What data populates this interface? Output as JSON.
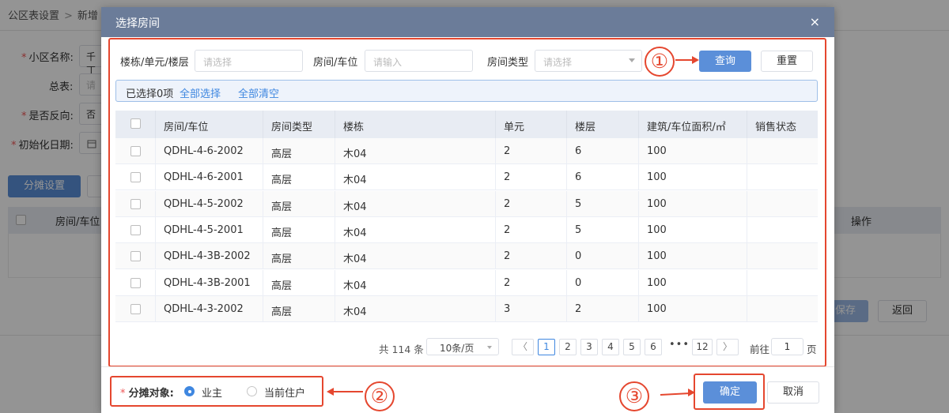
{
  "background": {
    "breadcrumb": [
      "公区表设置",
      "新增"
    ],
    "fields": [
      {
        "label": "小区名称:",
        "required": true,
        "value": "千丁"
      },
      {
        "label": "总表:",
        "required": false,
        "value": "请"
      },
      {
        "label": "是否反向:",
        "required": true,
        "value": "否"
      },
      {
        "label": "初始化日期:",
        "required": true,
        "value": ""
      }
    ],
    "allot_button": "分摊设置",
    "table_headers": [
      "房间/车位",
      "操作"
    ],
    "save_button": "保存",
    "back_button": "返回"
  },
  "dialog": {
    "title": "选择房间",
    "close_icon": "×",
    "filters": {
      "building_label": "楼栋/单元/楼层",
      "building_placeholder": "请选择",
      "room_label": "房间/车位",
      "room_placeholder": "请输入",
      "type_label": "房间类型",
      "type_placeholder": "请选择",
      "query_button": "查询",
      "reset_button": "重置"
    },
    "selection": {
      "count_text": "已选择0项",
      "select_all": "全部选择",
      "clear_all": "全部清空"
    },
    "columns": [
      "房间/车位",
      "房间类型",
      "楼栋",
      "单元",
      "楼层",
      "建筑/车位面积/㎡",
      "销售状态"
    ],
    "rows": [
      {
        "room": "QDHL-4-6-2002",
        "type": "高层",
        "building": "木04",
        "unit": "2",
        "floor": "6",
        "area": "100",
        "status": ""
      },
      {
        "room": "QDHL-4-6-2001",
        "type": "高层",
        "building": "木04",
        "unit": "2",
        "floor": "6",
        "area": "100",
        "status": ""
      },
      {
        "room": "QDHL-4-5-2002",
        "type": "高层",
        "building": "木04",
        "unit": "2",
        "floor": "5",
        "area": "100",
        "status": ""
      },
      {
        "room": "QDHL-4-5-2001",
        "type": "高层",
        "building": "木04",
        "unit": "2",
        "floor": "5",
        "area": "100",
        "status": ""
      },
      {
        "room": "QDHL-4-3B-2002",
        "type": "高层",
        "building": "木04",
        "unit": "2",
        "floor": "0",
        "area": "100",
        "status": ""
      },
      {
        "room": "QDHL-4-3B-2001",
        "type": "高层",
        "building": "木04",
        "unit": "2",
        "floor": "0",
        "area": "100",
        "status": ""
      },
      {
        "room": "QDHL-4-3-2002",
        "type": "高层",
        "building": "木04",
        "unit": "3",
        "floor": "2",
        "area": "100",
        "status": ""
      }
    ],
    "pagination": {
      "total": "共 114 条",
      "page_size": "10条/页",
      "prev_icon": "〈",
      "next_icon": "〉",
      "pages": [
        "1",
        "2",
        "3",
        "4",
        "5",
        "6"
      ],
      "ellipsis": "•••",
      "last_page": "12",
      "current_page": "1",
      "goto_label": "前往",
      "goto_value": "1",
      "page_suffix": "页"
    },
    "allot_target": {
      "label": "分摊对象:",
      "required_mark": "*",
      "options": [
        {
          "label": "业主",
          "selected": true
        },
        {
          "label": "当前住户",
          "selected": false
        }
      ]
    },
    "confirm_button": "确定",
    "cancel_button": "取消"
  },
  "annotations": {
    "markers": [
      "①",
      "②",
      "③"
    ],
    "color": "#e5472f"
  }
}
